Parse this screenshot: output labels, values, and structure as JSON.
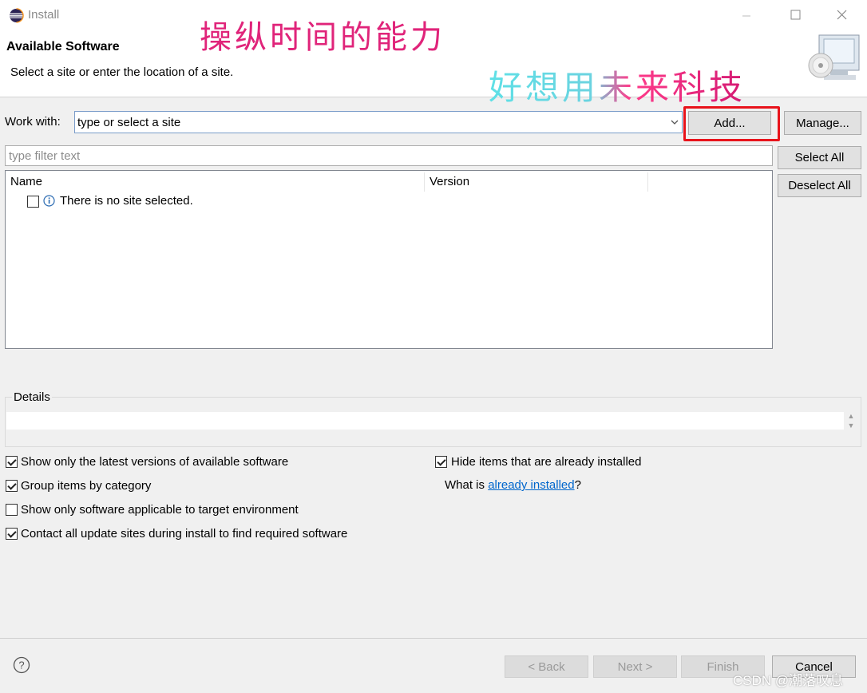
{
  "window": {
    "title": "Install",
    "controls": [
      "minimize",
      "maximize",
      "close"
    ]
  },
  "header": {
    "title": "Available Software",
    "subtitle": "Select a site or enter the location of a site."
  },
  "overlay_annotations": {
    "line1": "操纵时间的能力",
    "line2": "好想用未来科技"
  },
  "work_with": {
    "label": "Work with:",
    "value": "type or select a site",
    "add_label": "Add...",
    "manage_label": "Manage..."
  },
  "filter": {
    "placeholder": "type filter text"
  },
  "selection": {
    "select_all": "Select All",
    "deselect_all": "Deselect All"
  },
  "table": {
    "columns": [
      "Name",
      "Version"
    ],
    "rows": [
      {
        "checked": false,
        "icon": "info-icon",
        "text": "There is no site selected."
      }
    ]
  },
  "details": {
    "label": "Details",
    "value": ""
  },
  "options": {
    "left": [
      {
        "label": "Show only the latest versions of available software",
        "checked": true
      },
      {
        "label": "Group items by category",
        "checked": true
      },
      {
        "label": "Show only software applicable to target environment",
        "checked": false
      },
      {
        "label": "Contact all update sites during install to find required software",
        "checked": true
      }
    ],
    "right": [
      {
        "label": "Hide items that are already installed",
        "checked": true
      }
    ],
    "what_is_prefix": "What is ",
    "what_is_link": "already installed",
    "what_is_suffix": "?"
  },
  "footer": {
    "back": "< Back",
    "next": "Next >",
    "finish": "Finish",
    "cancel": "Cancel"
  },
  "watermark": "CSDN @潮落叹息",
  "colors": {
    "accent_highlight": "#e8131b",
    "link": "#0066cc",
    "overlay_pink": "#e0247a",
    "overlay_cyan": "#5fe0e6"
  }
}
